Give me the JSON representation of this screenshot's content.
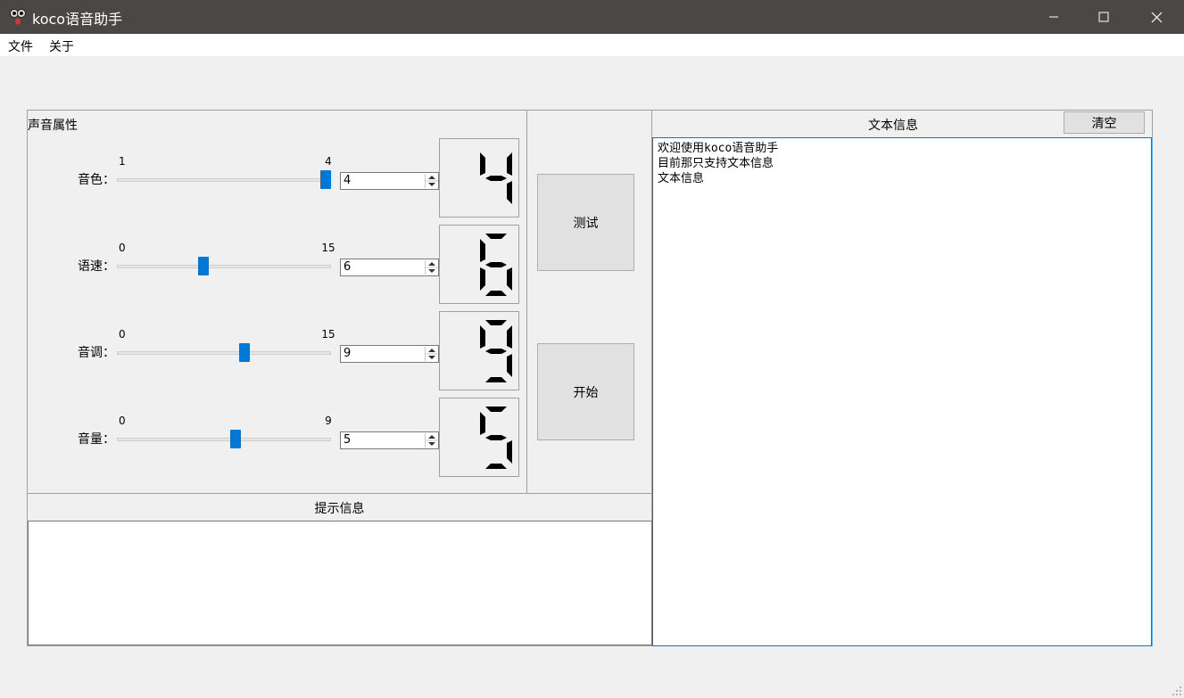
{
  "window": {
    "title": "koco语音助手",
    "controls": [
      "minimize",
      "maximize",
      "close"
    ]
  },
  "menu": {
    "items": [
      "文件",
      "关于"
    ]
  },
  "voice_panel": {
    "title": "声音属性",
    "rows": [
      {
        "label": "音色：",
        "min": "1",
        "max": "4",
        "value": "4",
        "fraction": 1.0,
        "lcd": "4"
      },
      {
        "label": "语速：",
        "min": "0",
        "max": "15",
        "value": "6",
        "fraction": 0.4,
        "lcd": "6"
      },
      {
        "label": "音调：",
        "min": "0",
        "max": "15",
        "value": "9",
        "fraction": 0.6,
        "lcd": "9"
      },
      {
        "label": "音量：",
        "min": "0",
        "max": "9",
        "value": "5",
        "fraction": 0.5556,
        "lcd": "5"
      }
    ]
  },
  "actions": {
    "test_label": "测试",
    "start_label": "开始"
  },
  "hint": {
    "title": "提示信息",
    "content": ""
  },
  "text_panel": {
    "title": "文本信息",
    "clear_label": "清空",
    "lines": [
      "欢迎使用koco语音助手",
      "目前那只支持文本信息",
      "文本信息"
    ]
  },
  "colors": {
    "accent": "#0078d7",
    "titlebar": "#4a4845",
    "background": "#f0f0f0",
    "lcd_segment": "#000000"
  }
}
